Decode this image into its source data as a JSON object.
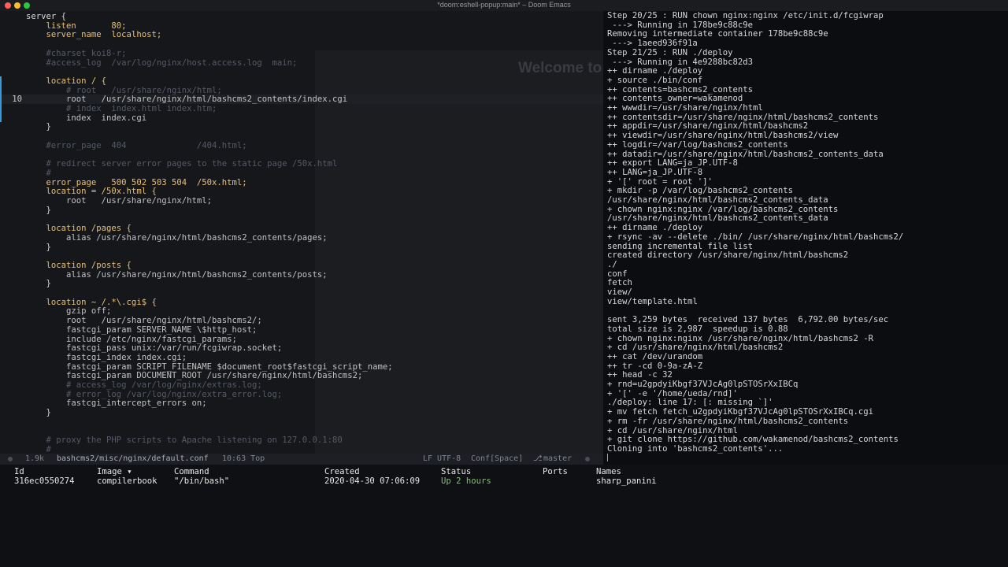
{
  "window": {
    "title": "*doom:eshell-popup:main* – Doom Emacs"
  },
  "editor": {
    "current_line": 10,
    "lines": [
      {
        "n": "",
        "text": "server {",
        "cls": "c-txt"
      },
      {
        "n": "",
        "text": "    listen       80;",
        "cls": "c-kw"
      },
      {
        "n": "",
        "text": "    server_name  localhost;",
        "cls": "c-kw"
      },
      {
        "n": "",
        "text": "",
        "cls": "c-txt"
      },
      {
        "n": "",
        "text": "    #charset koi8-r;",
        "cls": "c-com"
      },
      {
        "n": "",
        "text": "    #access_log  /var/log/nginx/host.access.log  main;",
        "cls": "c-com"
      },
      {
        "n": "",
        "text": "",
        "cls": "c-txt"
      },
      {
        "n": "",
        "text": "    location / {",
        "cls": "c-kw"
      },
      {
        "n": "",
        "text": "        # root   /usr/share/nginx/html;",
        "cls": "c-com"
      },
      {
        "n": "10",
        "text": "        root   /usr/share/nginx/html/bashcms2_contents/index.cgi",
        "cls": "c-dir"
      },
      {
        "n": "",
        "text": "        # index  index.html index.htm;",
        "cls": "c-com"
      },
      {
        "n": "",
        "text": "        index  index.cgi",
        "cls": "c-dir"
      },
      {
        "n": "",
        "text": "    }",
        "cls": "c-txt"
      },
      {
        "n": "",
        "text": "",
        "cls": "c-txt"
      },
      {
        "n": "",
        "text": "    #error_page  404              /404.html;",
        "cls": "c-com"
      },
      {
        "n": "",
        "text": "",
        "cls": "c-txt"
      },
      {
        "n": "",
        "text": "    # redirect server error pages to the static page /50x.html",
        "cls": "c-com"
      },
      {
        "n": "",
        "text": "    #",
        "cls": "c-com"
      },
      {
        "n": "",
        "text": "    error_page   500 502 503 504  /50x.html;",
        "cls": "c-kw"
      },
      {
        "n": "",
        "text": "    location = /50x.html {",
        "cls": "c-kw"
      },
      {
        "n": "",
        "text": "        root   /usr/share/nginx/html;",
        "cls": "c-dir"
      },
      {
        "n": "",
        "text": "    }",
        "cls": "c-txt"
      },
      {
        "n": "",
        "text": "",
        "cls": "c-txt"
      },
      {
        "n": "",
        "text": "    location /pages {",
        "cls": "c-kw"
      },
      {
        "n": "",
        "text": "        alias /usr/share/nginx/html/bashcms2_contents/pages;",
        "cls": "c-dir"
      },
      {
        "n": "",
        "text": "    }",
        "cls": "c-txt"
      },
      {
        "n": "",
        "text": "",
        "cls": "c-txt"
      },
      {
        "n": "",
        "text": "    location /posts {",
        "cls": "c-kw"
      },
      {
        "n": "",
        "text": "        alias /usr/share/nginx/html/bashcms2_contents/posts;",
        "cls": "c-dir"
      },
      {
        "n": "",
        "text": "    }",
        "cls": "c-txt"
      },
      {
        "n": "",
        "text": "",
        "cls": "c-txt"
      },
      {
        "n": "",
        "text": "    location ~ /.*\\.cgi$ {",
        "cls": "c-kw"
      },
      {
        "n": "",
        "text": "        gzip off;",
        "cls": "c-dir"
      },
      {
        "n": "",
        "text": "        root   /usr/share/nginx/html/bashcms2/;",
        "cls": "c-dir"
      },
      {
        "n": "",
        "text": "        fastcgi_param SERVER_NAME \\$http_host;",
        "cls": "c-dir"
      },
      {
        "n": "",
        "text": "        include /etc/nginx/fastcgi_params;",
        "cls": "c-dir"
      },
      {
        "n": "",
        "text": "        fastcgi_pass unix:/var/run/fcgiwrap.socket;",
        "cls": "c-dir"
      },
      {
        "n": "",
        "text": "        fastcgi_index index.cgi;",
        "cls": "c-dir"
      },
      {
        "n": "",
        "text": "        fastcgi_param SCRIPT_FILENAME $document_root$fastcgi_script_name;",
        "cls": "c-dir"
      },
      {
        "n": "",
        "text": "        fastcgi_param DOCUMENT_ROOT /usr/share/nginx/html/bashcms2;",
        "cls": "c-dir"
      },
      {
        "n": "",
        "text": "        # access_log /var/log/nginx/extras.log;",
        "cls": "c-com"
      },
      {
        "n": "",
        "text": "        # error_log /var/log/nginx/extra_error.log;",
        "cls": "c-com"
      },
      {
        "n": "",
        "text": "        fastcgi_intercept_errors on;",
        "cls": "c-dir"
      },
      {
        "n": "",
        "text": "    }",
        "cls": "c-txt"
      },
      {
        "n": "",
        "text": "",
        "cls": "c-txt"
      },
      {
        "n": "",
        "text": "",
        "cls": "c-txt"
      },
      {
        "n": "",
        "text": "    # proxy the PHP scripts to Apache listening on 127.0.0.1:80",
        "cls": "c-com"
      },
      {
        "n": "",
        "text": "    #",
        "cls": "c-com"
      }
    ],
    "ghost_heading": "Welcome to"
  },
  "modeline": {
    "size": "1.9k",
    "file": "bashcms2/misc/nginx/default.conf",
    "position": "10:63 Top",
    "encoding": "LF UTF-8",
    "mode": "Conf[Space]",
    "branch": "master"
  },
  "terminal": {
    "lines": [
      "Step 20/25 : RUN chown nginx:nginx /etc/init.d/fcgiwrap",
      " ---> Running in 178be9c88c9e",
      "Removing intermediate container 178be9c88c9e",
      " ---> 1aeed936f91a",
      "Step 21/25 : RUN ./deploy",
      " ---> Running in 4e9288bc82d3",
      "++ dirname ./deploy",
      "+ source ./bin/conf",
      "++ contents=bashcms2_contents",
      "++ contents_owner=wakamenod",
      "++ wwwdir=/usr/share/nginx/html",
      "++ contentsdir=/usr/share/nginx/html/bashcms2_contents",
      "++ appdir=/usr/share/nginx/html/bashcms2",
      "++ viewdir=/usr/share/nginx/html/bashcms2/view",
      "++ logdir=/var/log/bashcms2_contents",
      "++ datadir=/usr/share/nginx/html/bashcms2_contents_data",
      "++ export LANG=ja_JP.UTF-8",
      "++ LANG=ja_JP.UTF-8",
      "+ '[' root = root ']'",
      "+ mkdir -p /var/log/bashcms2_contents",
      "/usr/share/nginx/html/bashcms2_contents_data",
      "+ chown nginx:nginx /var/log/bashcms2_contents",
      "/usr/share/nginx/html/bashcms2_contents_data",
      "++ dirname ./deploy",
      "+ rsync -av --delete ./bin/ /usr/share/nginx/html/bashcms2/",
      "sending incremental file list",
      "created directory /usr/share/nginx/html/bashcms2",
      "./",
      "conf",
      "fetch",
      "view/",
      "view/template.html",
      "",
      "sent 3,259 bytes  received 137 bytes  6,792.00 bytes/sec",
      "total size is 2,987  speedup is 0.88",
      "+ chown nginx:nginx /usr/share/nginx/html/bashcms2 -R",
      "+ cd /usr/share/nginx/html/bashcms2",
      "++ cat /dev/urandom",
      "++ tr -cd 0-9a-zA-Z",
      "++ head -c 32",
      "+ rnd=u2gpdyiKbgf37VJcAg0lpSTOSrXxIBCq",
      "+ '[' -e '/home/ueda/rnd]'",
      "./deploy: line 17: [: missing `]'",
      "+ mv fetch fetch_u2gpdyiKbgf37VJcAg0lpSTOSrXxIBCq.cgi",
      "+ rm -fr /usr/share/nginx/html/bashcms2_contents",
      "+ cd /usr/share/nginx/html",
      "+ git clone https://github.com/wakamenod/bashcms2_contents",
      "Cloning into 'bashcms2_contents'..."
    ]
  },
  "containers": {
    "headers": {
      "id": "Id",
      "image": "Image ▾",
      "command": "Command",
      "created": "Created",
      "status": "Status",
      "ports": "Ports",
      "names": "Names"
    },
    "row": {
      "id": "316ec0550274",
      "image": "compilerbook",
      "command": "\"/bin/bash\"",
      "created": "2020-04-30 07:06:09",
      "status": "Up 2 hours",
      "ports": "",
      "names": "sharp_panini"
    }
  }
}
